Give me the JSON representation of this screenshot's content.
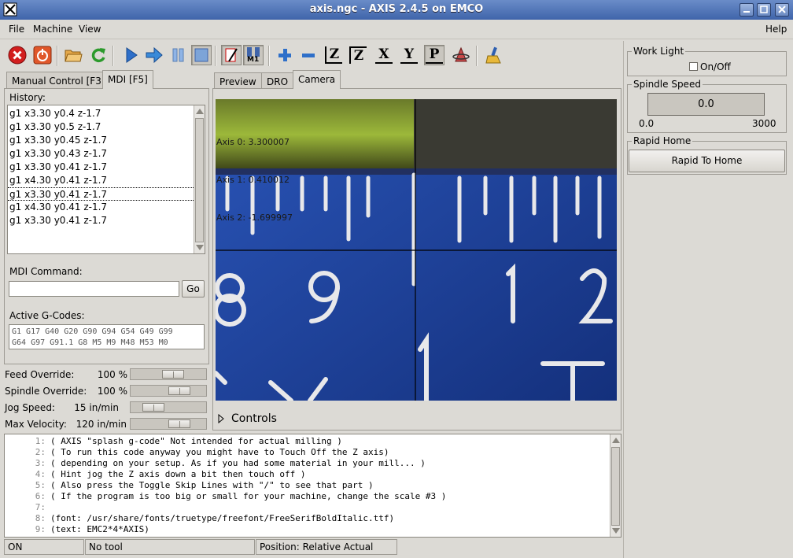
{
  "window": {
    "title": "axis.ngc - AXIS 2.4.5 on EMCO"
  },
  "menu": {
    "file": "File",
    "machine": "Machine",
    "view": "View",
    "help": "Help"
  },
  "toolbar": {
    "icons": [
      "estop-icon",
      "machine-power-icon",
      "open-file-icon",
      "reload-icon",
      "run-icon",
      "step-icon",
      "pause-icon",
      "stop-icon",
      "block-delete-icon",
      "optional-stop-icon",
      "zoom-in-icon",
      "zoom-out-icon",
      "view-z-icon",
      "view-z2-icon",
      "view-x-icon",
      "view-y-icon",
      "view-p-icon",
      "rotate-icon",
      "clear-live-plot-icon"
    ],
    "axis_letters": {
      "z": "Z",
      "z2": "Z",
      "x": "X",
      "y": "Y",
      "p": "P"
    },
    "optional_stop_sub": "M1"
  },
  "left_tabs": {
    "manual": "Manual Control [F3]",
    "mdi": "MDI [F5]"
  },
  "mdi": {
    "history_label": "History:",
    "history": [
      "g1 x3.30 y0.4 z-1.7",
      "g1 x3.30 y0.5 z-1.7",
      "g1 x3.30 y0.45 z-1.7",
      "g1 x3.30 y0.43 z-1.7",
      "g1 x3.30 y0.41 z-1.7",
      "g1 x4.30 y0.41 z-1.7",
      "g1 x3.30 y0.41 z-1.7",
      "g1 x4.30 y0.41 z-1.7",
      "g1 x3.30 y0.41 z-1.7"
    ],
    "command_label": "MDI Command:",
    "command_value": "",
    "go_label": "Go",
    "active_gcodes_label": "Active G-Codes:",
    "active_gcodes_line1": "G1 G17 G40 G20 G90 G94 G54 G49 G99",
    "active_gcodes_line2": "G64 G97 G91.1 G8 M5 M9 M48 M53 M0"
  },
  "overrides": {
    "feed_label": "Feed Override:",
    "feed_value": "100 %",
    "feed_level": 0.6,
    "spindle_label": "Spindle Override:",
    "spindle_value": "100 %",
    "spindle_level": 0.72,
    "jog_label": "Jog Speed:",
    "jog_value": "15 in/min",
    "jog_level": 0.22,
    "maxvel_label": "Max Velocity:",
    "maxvel_value": "120 in/min",
    "maxvel_level": 0.72
  },
  "center_tabs": {
    "preview": "Preview",
    "dro": "DRO",
    "camera": "Camera"
  },
  "camera": {
    "axis0": "Axis 0: 3.300007",
    "axis1": "Axis 1: 0.410012",
    "axis2": "Axis 2: -1.699997",
    "controls_label": "Controls"
  },
  "gcode": {
    "lines": [
      {
        "n": "1:",
        "text": "( AXIS \"splash g-code\" Not intended for actual milling )"
      },
      {
        "n": "2:",
        "text": "( To run this code anyway you might have to Touch Off the Z axis)"
      },
      {
        "n": "3:",
        "text": "( depending on your setup. As if you had some material in your mill... )"
      },
      {
        "n": "4:",
        "text": "( Hint jog the Z axis down a bit then touch off )"
      },
      {
        "n": "5:",
        "text": "( Also press the Toggle Skip Lines with \"/\" to see that part )"
      },
      {
        "n": "6:",
        "text": "( If the program is too big or small for your machine, change the scale #3 )"
      },
      {
        "n": "7:",
        "text": ""
      },
      {
        "n": "8:",
        "text": "(font: /usr/share/fonts/truetype/freefont/FreeSerifBoldItalic.ttf)"
      },
      {
        "n": "9:",
        "text": "(text: EMC2*4*AXIS)"
      }
    ]
  },
  "status": {
    "state": "ON",
    "tool": "No tool",
    "position": "Position: Relative Actual"
  },
  "side": {
    "work_light_title": "Work Light",
    "work_light_checkbox": "On/Off",
    "spindle_speed_title": "Spindle Speed",
    "spindle_speed_value": "0.0",
    "spindle_min": "0.0",
    "spindle_max": "3000",
    "rapid_home_title": "Rapid Home",
    "rapid_home_button": "Rapid To Home"
  }
}
